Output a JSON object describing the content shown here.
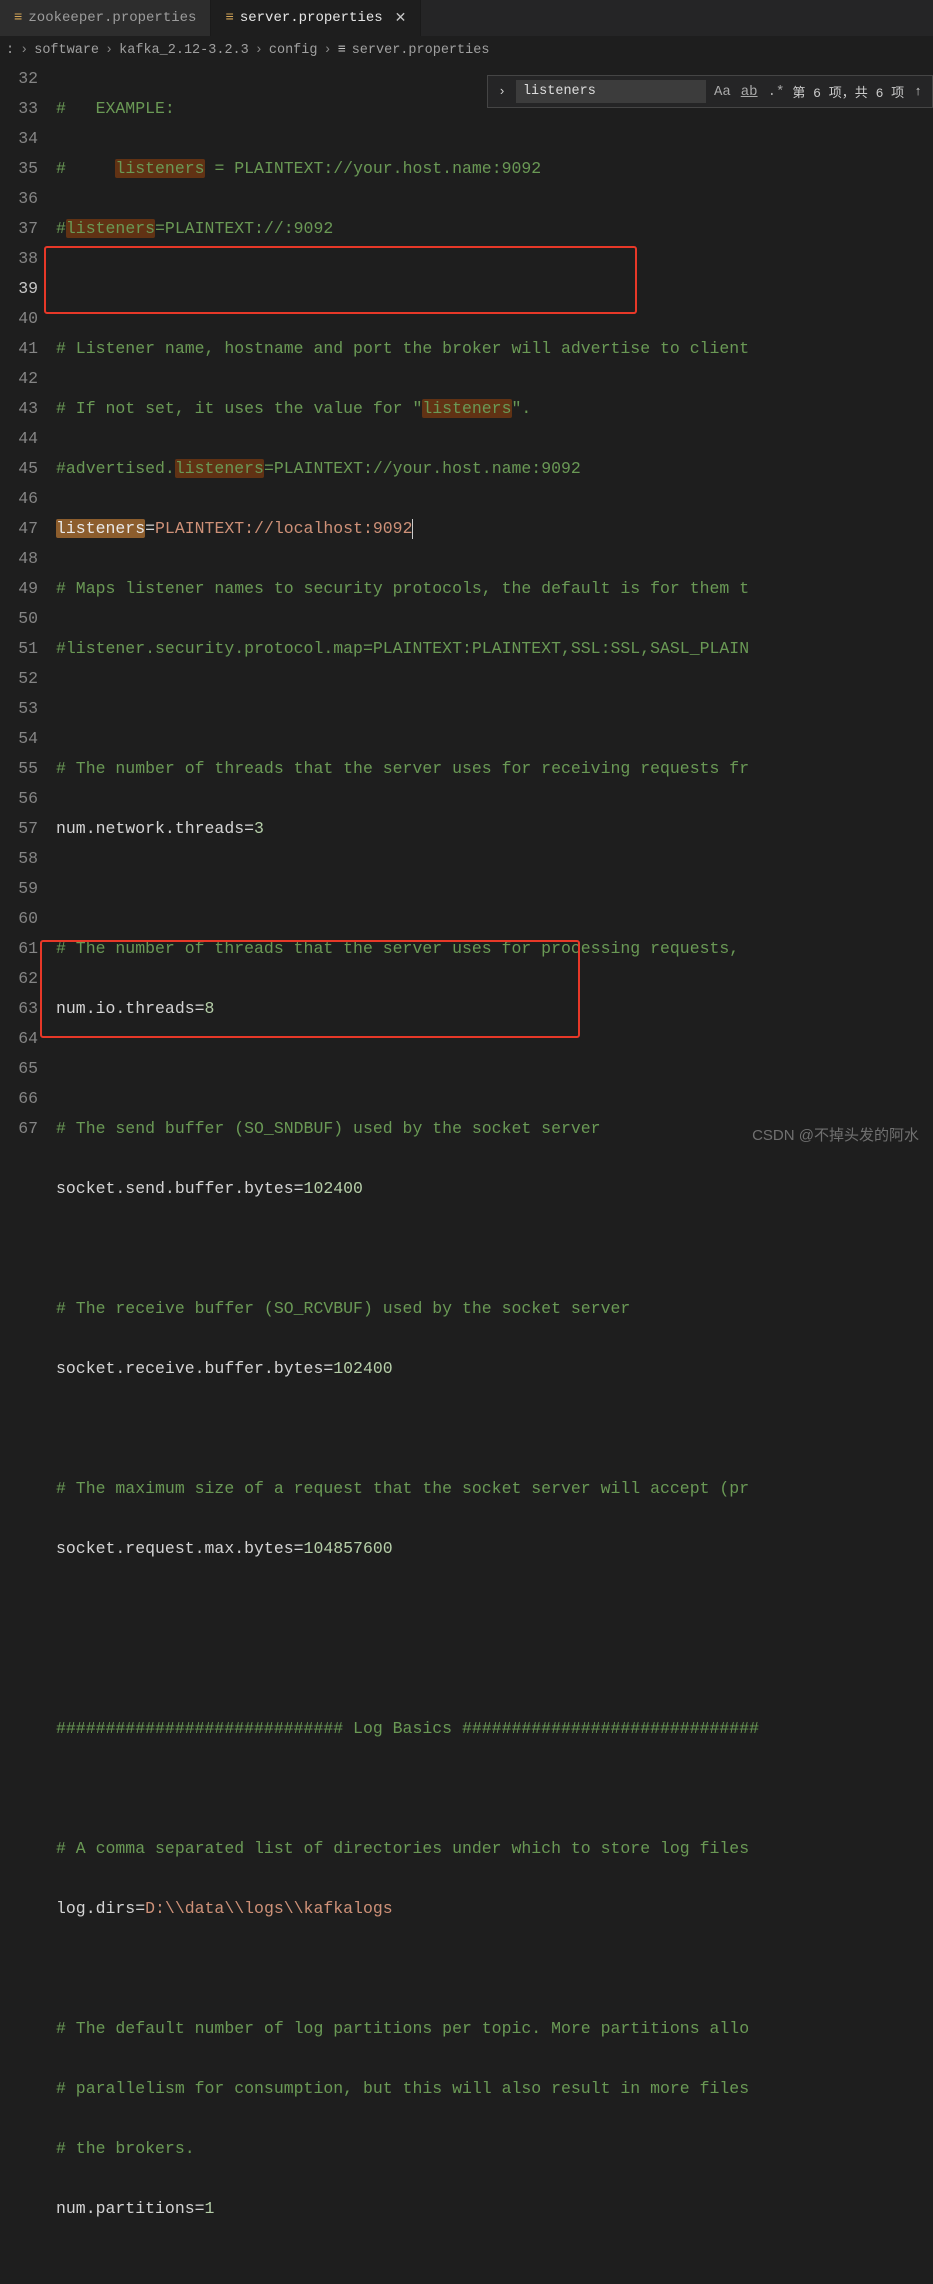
{
  "tabs": {
    "inactive": "zookeeper.properties",
    "active": "server.properties",
    "tab_icon": "≡",
    "close": "✕"
  },
  "breadcrumbs": {
    "drive_suffix": ":",
    "arrow": "›",
    "items": [
      "software",
      "kafka_2.12-3.2.3",
      "config",
      "server.properties"
    ]
  },
  "find": {
    "chev": "›",
    "value": "listeners",
    "opt_aa": "Aa",
    "opt_ab": "ab",
    "opt_re": ".*",
    "result": "第 6 项，共 6 项",
    "nav_up": "↑"
  },
  "gutter": [
    "32",
    "33",
    "34",
    "35",
    "36",
    "37",
    "38",
    "39",
    "40",
    "41",
    "42",
    "43",
    "44",
    "45",
    "46",
    "47",
    "48",
    "49",
    "50",
    "51",
    "52",
    "53",
    "54",
    "55",
    "56",
    "57",
    "58",
    "59",
    "60",
    "61",
    "62",
    "63",
    "64",
    "65",
    "66",
    "67"
  ],
  "current_line": "39",
  "code": {
    "l32_a": "#   EXAMPLE:",
    "l33_a": "#     ",
    "l33_hl": "listeners",
    "l33_b": " = PLAINTEXT://your.host.name:9092",
    "l34_a": "#",
    "l34_hl": "listeners",
    "l34_b": "=PLAINTEXT://:9092",
    "l36": "# Listener name, hostname and port the broker will advertise to client",
    "l37_a": "# If not set, it uses the value for \"",
    "l37_hl": "listeners",
    "l37_b": "\".",
    "l38_a": "#advertised.",
    "l38_hl": "listeners",
    "l38_b": "=PLAINTEXT://your.host.name:9092",
    "l39_hl": "listeners",
    "l39_eq": "=",
    "l39_val": "PLAINTEXT://localhost:9092",
    "l40": "# Maps listener names to security protocols, the default is for them t",
    "l41": "#listener.security.protocol.map=PLAINTEXT:PLAINTEXT,SSL:SSL,SASL_PLAIN",
    "l43": "# The number of threads that the server uses for receiving requests fr",
    "l44_k": "num.network.threads",
    "l44_v": "3",
    "l46": "# The number of threads that the server uses for processing requests,",
    "l47_k": "num.io.threads",
    "l47_v": "8",
    "l49": "# The send buffer (SO_SNDBUF) used by the socket server",
    "l50_k": "socket.send.buffer.bytes",
    "l50_v": "102400",
    "l52": "# The receive buffer (SO_RCVBUF) used by the socket server",
    "l53_k": "socket.receive.buffer.bytes",
    "l53_v": "102400",
    "l55": "# The maximum size of a request that the socket server will accept (pr",
    "l56_k": "socket.request.max.bytes",
    "l56_v": "104857600",
    "l59": "############################# Log Basics ##############################",
    "l61": "# A comma separated list of directories under which to store log files",
    "l62_k": "log.dirs",
    "l62_v": "D:\\\\data\\\\logs\\\\kafkalogs",
    "l64": "# The default number of log partitions per topic. More partitions allo",
    "l65": "# parallelism for consumption, but this will also result in more files",
    "l66": "# the brokers.",
    "l67_k": "num.partitions",
    "l67_v": "1"
  },
  "watermark": "CSDN @不掉头发的阿水"
}
